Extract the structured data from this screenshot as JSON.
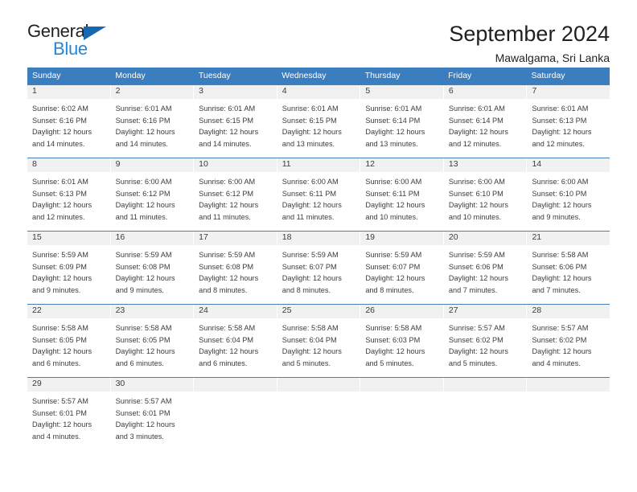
{
  "logo": {
    "word1": "General",
    "word2": "Blue",
    "accent_color": "#1668b3",
    "blue_text_color": "#2387d6"
  },
  "header": {
    "title": "September 2024",
    "subtitle": "Mawalgama, Sri Lanka"
  },
  "calendar": {
    "header_bg": "#3b7ec0",
    "daynum_bg": "#f1f1f1",
    "weekdays": [
      "Sunday",
      "Monday",
      "Tuesday",
      "Wednesday",
      "Thursday",
      "Friday",
      "Saturday"
    ],
    "weeks": [
      [
        {
          "day": "1",
          "sunrise": "Sunrise: 6:02 AM",
          "sunset": "Sunset: 6:16 PM",
          "daylight1": "Daylight: 12 hours",
          "daylight2": "and 14 minutes."
        },
        {
          "day": "2",
          "sunrise": "Sunrise: 6:01 AM",
          "sunset": "Sunset: 6:16 PM",
          "daylight1": "Daylight: 12 hours",
          "daylight2": "and 14 minutes."
        },
        {
          "day": "3",
          "sunrise": "Sunrise: 6:01 AM",
          "sunset": "Sunset: 6:15 PM",
          "daylight1": "Daylight: 12 hours",
          "daylight2": "and 14 minutes."
        },
        {
          "day": "4",
          "sunrise": "Sunrise: 6:01 AM",
          "sunset": "Sunset: 6:15 PM",
          "daylight1": "Daylight: 12 hours",
          "daylight2": "and 13 minutes."
        },
        {
          "day": "5",
          "sunrise": "Sunrise: 6:01 AM",
          "sunset": "Sunset: 6:14 PM",
          "daylight1": "Daylight: 12 hours",
          "daylight2": "and 13 minutes."
        },
        {
          "day": "6",
          "sunrise": "Sunrise: 6:01 AM",
          "sunset": "Sunset: 6:14 PM",
          "daylight1": "Daylight: 12 hours",
          "daylight2": "and 12 minutes."
        },
        {
          "day": "7",
          "sunrise": "Sunrise: 6:01 AM",
          "sunset": "Sunset: 6:13 PM",
          "daylight1": "Daylight: 12 hours",
          "daylight2": "and 12 minutes."
        }
      ],
      [
        {
          "day": "8",
          "sunrise": "Sunrise: 6:01 AM",
          "sunset": "Sunset: 6:13 PM",
          "daylight1": "Daylight: 12 hours",
          "daylight2": "and 12 minutes."
        },
        {
          "day": "9",
          "sunrise": "Sunrise: 6:00 AM",
          "sunset": "Sunset: 6:12 PM",
          "daylight1": "Daylight: 12 hours",
          "daylight2": "and 11 minutes."
        },
        {
          "day": "10",
          "sunrise": "Sunrise: 6:00 AM",
          "sunset": "Sunset: 6:12 PM",
          "daylight1": "Daylight: 12 hours",
          "daylight2": "and 11 minutes."
        },
        {
          "day": "11",
          "sunrise": "Sunrise: 6:00 AM",
          "sunset": "Sunset: 6:11 PM",
          "daylight1": "Daylight: 12 hours",
          "daylight2": "and 11 minutes."
        },
        {
          "day": "12",
          "sunrise": "Sunrise: 6:00 AM",
          "sunset": "Sunset: 6:11 PM",
          "daylight1": "Daylight: 12 hours",
          "daylight2": "and 10 minutes."
        },
        {
          "day": "13",
          "sunrise": "Sunrise: 6:00 AM",
          "sunset": "Sunset: 6:10 PM",
          "daylight1": "Daylight: 12 hours",
          "daylight2": "and 10 minutes."
        },
        {
          "day": "14",
          "sunrise": "Sunrise: 6:00 AM",
          "sunset": "Sunset: 6:10 PM",
          "daylight1": "Daylight: 12 hours",
          "daylight2": "and 9 minutes."
        }
      ],
      [
        {
          "day": "15",
          "sunrise": "Sunrise: 5:59 AM",
          "sunset": "Sunset: 6:09 PM",
          "daylight1": "Daylight: 12 hours",
          "daylight2": "and 9 minutes."
        },
        {
          "day": "16",
          "sunrise": "Sunrise: 5:59 AM",
          "sunset": "Sunset: 6:08 PM",
          "daylight1": "Daylight: 12 hours",
          "daylight2": "and 9 minutes."
        },
        {
          "day": "17",
          "sunrise": "Sunrise: 5:59 AM",
          "sunset": "Sunset: 6:08 PM",
          "daylight1": "Daylight: 12 hours",
          "daylight2": "and 8 minutes."
        },
        {
          "day": "18",
          "sunrise": "Sunrise: 5:59 AM",
          "sunset": "Sunset: 6:07 PM",
          "daylight1": "Daylight: 12 hours",
          "daylight2": "and 8 minutes."
        },
        {
          "day": "19",
          "sunrise": "Sunrise: 5:59 AM",
          "sunset": "Sunset: 6:07 PM",
          "daylight1": "Daylight: 12 hours",
          "daylight2": "and 8 minutes."
        },
        {
          "day": "20",
          "sunrise": "Sunrise: 5:59 AM",
          "sunset": "Sunset: 6:06 PM",
          "daylight1": "Daylight: 12 hours",
          "daylight2": "and 7 minutes."
        },
        {
          "day": "21",
          "sunrise": "Sunrise: 5:58 AM",
          "sunset": "Sunset: 6:06 PM",
          "daylight1": "Daylight: 12 hours",
          "daylight2": "and 7 minutes."
        }
      ],
      [
        {
          "day": "22",
          "sunrise": "Sunrise: 5:58 AM",
          "sunset": "Sunset: 6:05 PM",
          "daylight1": "Daylight: 12 hours",
          "daylight2": "and 6 minutes."
        },
        {
          "day": "23",
          "sunrise": "Sunrise: 5:58 AM",
          "sunset": "Sunset: 6:05 PM",
          "daylight1": "Daylight: 12 hours",
          "daylight2": "and 6 minutes."
        },
        {
          "day": "24",
          "sunrise": "Sunrise: 5:58 AM",
          "sunset": "Sunset: 6:04 PM",
          "daylight1": "Daylight: 12 hours",
          "daylight2": "and 6 minutes."
        },
        {
          "day": "25",
          "sunrise": "Sunrise: 5:58 AM",
          "sunset": "Sunset: 6:04 PM",
          "daylight1": "Daylight: 12 hours",
          "daylight2": "and 5 minutes."
        },
        {
          "day": "26",
          "sunrise": "Sunrise: 5:58 AM",
          "sunset": "Sunset: 6:03 PM",
          "daylight1": "Daylight: 12 hours",
          "daylight2": "and 5 minutes."
        },
        {
          "day": "27",
          "sunrise": "Sunrise: 5:57 AM",
          "sunset": "Sunset: 6:02 PM",
          "daylight1": "Daylight: 12 hours",
          "daylight2": "and 5 minutes."
        },
        {
          "day": "28",
          "sunrise": "Sunrise: 5:57 AM",
          "sunset": "Sunset: 6:02 PM",
          "daylight1": "Daylight: 12 hours",
          "daylight2": "and 4 minutes."
        }
      ],
      [
        {
          "day": "29",
          "sunrise": "Sunrise: 5:57 AM",
          "sunset": "Sunset: 6:01 PM",
          "daylight1": "Daylight: 12 hours",
          "daylight2": "and 4 minutes."
        },
        {
          "day": "30",
          "sunrise": "Sunrise: 5:57 AM",
          "sunset": "Sunset: 6:01 PM",
          "daylight1": "Daylight: 12 hours",
          "daylight2": "and 3 minutes."
        },
        {
          "day": "",
          "sunrise": "",
          "sunset": "",
          "daylight1": "",
          "daylight2": ""
        },
        {
          "day": "",
          "sunrise": "",
          "sunset": "",
          "daylight1": "",
          "daylight2": ""
        },
        {
          "day": "",
          "sunrise": "",
          "sunset": "",
          "daylight1": "",
          "daylight2": ""
        },
        {
          "day": "",
          "sunrise": "",
          "sunset": "",
          "daylight1": "",
          "daylight2": ""
        },
        {
          "day": "",
          "sunrise": "",
          "sunset": "",
          "daylight1": "",
          "daylight2": ""
        }
      ]
    ]
  }
}
